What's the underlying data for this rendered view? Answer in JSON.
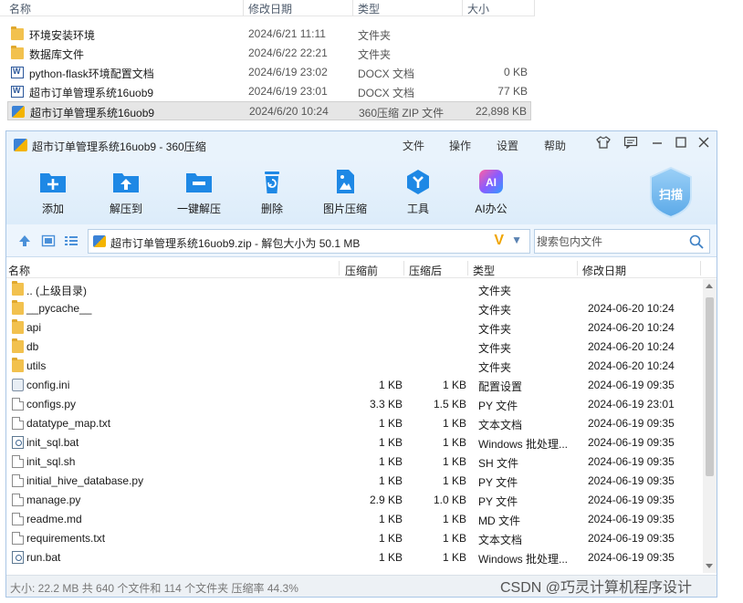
{
  "explorer": {
    "headers": {
      "name": "名称",
      "date": "修改日期",
      "type": "类型",
      "size": "大小"
    },
    "rows": [
      {
        "name": "环境安装环境",
        "date": "2024/6/21 11:11",
        "type": "文件夹",
        "size": "",
        "icon": "folder-icon"
      },
      {
        "name": "数据库文件",
        "date": "2024/6/22 22:21",
        "type": "文件夹",
        "size": "",
        "icon": "folder-icon"
      },
      {
        "name": "python-flask环境配置文档",
        "date": "2024/6/19 23:02",
        "type": "DOCX 文档",
        "size": "0 KB",
        "icon": "docx-icon"
      },
      {
        "name": "超市订单管理系统16uob9",
        "date": "2024/6/19 23:01",
        "type": "DOCX 文档",
        "size": "77 KB",
        "icon": "docx-icon"
      },
      {
        "name": "超市订单管理系统16uob9",
        "date": "2024/6/20 10:24",
        "type": "360压缩 ZIP 文件",
        "size": "22,898 KB",
        "icon": "zip-icon",
        "selected": true
      }
    ]
  },
  "window": {
    "title": "超市订单管理系统16uob9 - 360压缩",
    "menu": [
      "文件",
      "操作",
      "设置",
      "帮助"
    ],
    "toolbar": [
      {
        "label": "添加",
        "icon": "add-icon",
        "color": "#1e88e5"
      },
      {
        "label": "解压到",
        "icon": "extract-to-icon",
        "color": "#1e88e5"
      },
      {
        "label": "一键解压",
        "icon": "one-click-extract-icon",
        "color": "#1e88e5"
      },
      {
        "label": "删除",
        "icon": "delete-icon",
        "color": "#1e88e5"
      },
      {
        "label": "图片压缩",
        "icon": "image-compress-icon",
        "color": "#1e88e5"
      },
      {
        "label": "工具",
        "icon": "tools-icon",
        "color": "#1e88e5"
      },
      {
        "label": "AI办公",
        "icon": "ai-office-icon",
        "color": "#3a7bff"
      }
    ],
    "scan_label": "扫描",
    "path": "超市订单管理系统16uob9.zip - 解包大小为 50.1 MB",
    "search_placeholder": "搜索包内文件",
    "columns": {
      "name": "名称",
      "before": "压缩前",
      "after": "压缩后",
      "type": "类型",
      "date": "修改日期"
    },
    "files": [
      {
        "name": ".. (上级目录)",
        "before": "",
        "after": "",
        "type": "文件夹",
        "date": "",
        "icon": "folder"
      },
      {
        "name": "__pycache__",
        "before": "",
        "after": "",
        "type": "文件夹",
        "date": "2024-06-20 10:24",
        "icon": "folder"
      },
      {
        "name": "api",
        "before": "",
        "after": "",
        "type": "文件夹",
        "date": "2024-06-20 10:24",
        "icon": "folder"
      },
      {
        "name": "db",
        "before": "",
        "after": "",
        "type": "文件夹",
        "date": "2024-06-20 10:24",
        "icon": "folder"
      },
      {
        "name": "utils",
        "before": "",
        "after": "",
        "type": "文件夹",
        "date": "2024-06-20 10:24",
        "icon": "folder"
      },
      {
        "name": "config.ini",
        "before": "1 KB",
        "after": "1 KB",
        "type": "配置设置",
        "date": "2024-06-19 09:35",
        "icon": "ini"
      },
      {
        "name": "configs.py",
        "before": "3.3 KB",
        "after": "1.5 KB",
        "type": "PY 文件",
        "date": "2024-06-19 23:01",
        "icon": "file"
      },
      {
        "name": "datatype_map.txt",
        "before": "1 KB",
        "after": "1 KB",
        "type": "文本文档",
        "date": "2024-06-19 09:35",
        "icon": "file"
      },
      {
        "name": "init_sql.bat",
        "before": "1 KB",
        "after": "1 KB",
        "type": "Windows 批处理...",
        "date": "2024-06-19 09:35",
        "icon": "bat"
      },
      {
        "name": "init_sql.sh",
        "before": "1 KB",
        "after": "1 KB",
        "type": "SH 文件",
        "date": "2024-06-19 09:35",
        "icon": "file"
      },
      {
        "name": "initial_hive_database.py",
        "before": "1 KB",
        "after": "1 KB",
        "type": "PY 文件",
        "date": "2024-06-19 09:35",
        "icon": "file"
      },
      {
        "name": "manage.py",
        "before": "2.9 KB",
        "after": "1.0 KB",
        "type": "PY 文件",
        "date": "2024-06-19 09:35",
        "icon": "file"
      },
      {
        "name": "readme.md",
        "before": "1 KB",
        "after": "1 KB",
        "type": "MD 文件",
        "date": "2024-06-19 09:35",
        "icon": "file"
      },
      {
        "name": "requirements.txt",
        "before": "1 KB",
        "after": "1 KB",
        "type": "文本文档",
        "date": "2024-06-19 09:35",
        "icon": "file"
      },
      {
        "name": "run.bat",
        "before": "1 KB",
        "after": "1 KB",
        "type": "Windows 批处理...",
        "date": "2024-06-19 09:35",
        "icon": "bat"
      }
    ],
    "status": "大小: 22.2 MB 共 640 个文件和 114 个文件夹 压缩率 44.3%"
  },
  "watermark": "CSDN @巧灵计算机程序设计"
}
